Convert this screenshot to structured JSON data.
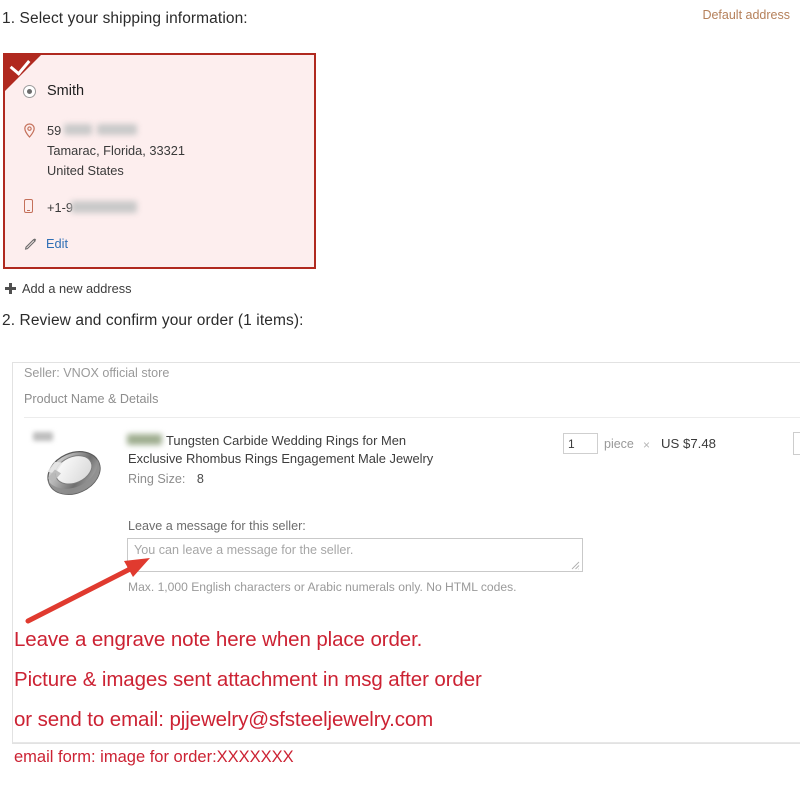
{
  "headings": {
    "shipping": "1. Select your shipping information:",
    "order": "2. Review and confirm your order (1 items):"
  },
  "address_card": {
    "default_badge": "Default address",
    "recipient": "Smith",
    "street": "59",
    "city_state_zip": "Tamarac, Florida, 33321",
    "country": "United States",
    "phone": "+1-9",
    "edit_label": "Edit",
    "accent_color": "#b0291f",
    "background_color": "#fdeeee",
    "badge_color": "#b5805a",
    "icons": {
      "selected_check": "check-icon",
      "radio": "radio-selected-icon",
      "location": "map-pin-icon",
      "phone": "mobile-phone-icon",
      "edit": "pencil-icon"
    }
  },
  "add_address": {
    "label": "Add a new address",
    "icon": "plus-icon"
  },
  "order_panel": {
    "seller": "Seller: VNOX official store",
    "column_header": "Product Name & Details",
    "product": {
      "title": "Tungsten Carbide Wedding Rings for Men Exclusive Rhombus Rings Engagement Male Jewelry",
      "attribute_label": "Ring Size:",
      "attribute_value": "8",
      "image_alt": "tungsten-carbide-ring"
    },
    "quantity": {
      "value": "1",
      "unit": "piece",
      "multiply_symbol": "×"
    },
    "unit_price": "US $7.48",
    "message": {
      "label": "Leave a message for this seller:",
      "placeholder": "You can leave a message for the seller.",
      "value": "",
      "hint": "Max. 1,000 English characters or Arabic numerals only. No HTML codes."
    }
  },
  "annotation": {
    "color": "#cc2233",
    "line1": "Leave a engrave note here when place order.",
    "line2": "Picture & images sent attachment in msg after order",
    "line3": "or send to email: pjjewelry@sfsteeljewelry.com",
    "line4": "email form: image for order:XXXXXXX"
  }
}
